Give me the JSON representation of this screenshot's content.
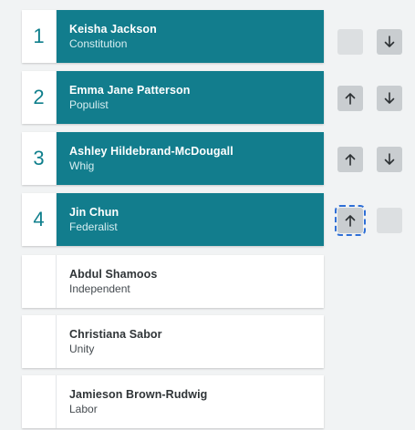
{
  "ranked": [
    {
      "rank": "1",
      "name": "Keisha Jackson",
      "party": "Constitution"
    },
    {
      "rank": "2",
      "name": "Emma Jane Patterson",
      "party": "Populist"
    },
    {
      "rank": "3",
      "name": "Ashley Hildebrand-McDougall",
      "party": "Whig"
    },
    {
      "rank": "4",
      "name": "Jin Chun",
      "party": "Federalist"
    }
  ],
  "unranked": [
    {
      "name": "Abdul Shamoos",
      "party": "Independent"
    },
    {
      "name": "Christiana Sabor",
      "party": "Unity"
    },
    {
      "name": "Jamieson Brown-Rudwig",
      "party": "Labor"
    }
  ],
  "controls": {
    "rows": [
      {
        "up": "disabled",
        "down": "enabled"
      },
      {
        "up": "enabled",
        "down": "enabled"
      },
      {
        "up": "enabled",
        "down": "enabled"
      },
      {
        "up": "focused",
        "down": "disabled"
      }
    ],
    "icons": {
      "up": "arrow-up-icon",
      "down": "arrow-down-icon"
    }
  },
  "colors": {
    "ranked_bg": "#127d8d",
    "rank_number": "#0f7f8c",
    "focus_outline": "#2f6fd6"
  }
}
